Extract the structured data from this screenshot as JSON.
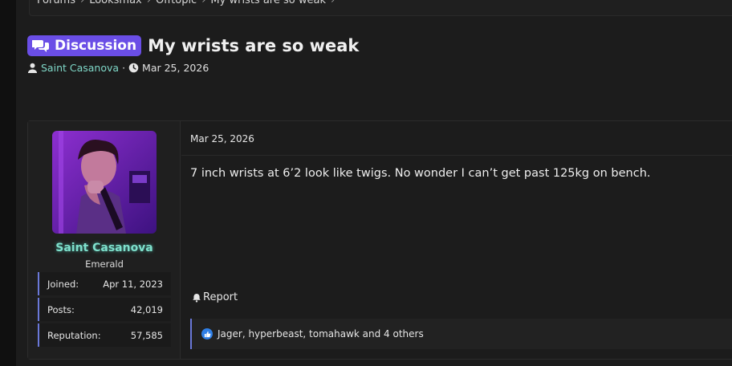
{
  "breadcrumb": {
    "items": [
      "Forums",
      "Looksmax",
      "Offtopic",
      "My wrists are so weak"
    ],
    "separator": "›"
  },
  "thread": {
    "prefix_label": "Discussion",
    "prefix_icon": "comments-icon",
    "title": "My wrists are so weak",
    "author": "Saint Casanova",
    "meta_separator": "·",
    "date": "Mar 25, 2026"
  },
  "post": {
    "user": {
      "name": "Saint Casanova",
      "title": "Emerald",
      "stats": [
        {
          "label": "Joined:",
          "value": "Apr 11, 2023"
        },
        {
          "label": "Posts:",
          "value": "42,019"
        },
        {
          "label": "Reputation:",
          "value": "57,585"
        }
      ]
    },
    "date": "Mar 25, 2026",
    "body": "7 inch wrists at 6’2 look like twigs. No wonder I can’t get past 125kg on bench.",
    "report_label": "Report",
    "reactions_text": "Jager, hyperbeast, tomahawk and 4 others"
  },
  "colors": {
    "accent_purple": "#6a4ee6",
    "username_teal": "#7fe0cc",
    "stat_border": "#6a78d8",
    "like_blue": "#2f7fe6"
  }
}
